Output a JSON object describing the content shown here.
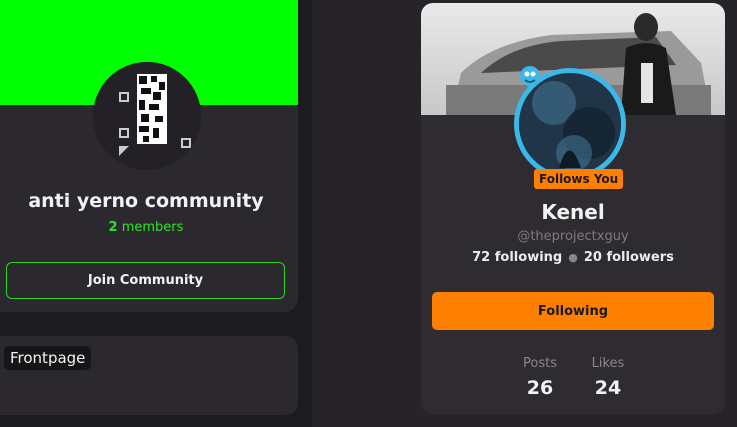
{
  "community": {
    "name": "anti yerno community",
    "member_count": "2",
    "member_label": "members",
    "join_label": "Join Community",
    "banner_color": "#00ff00"
  },
  "frontpage": {
    "label": "Frontpage"
  },
  "profile": {
    "follows_you_label": "Follows You",
    "name": "Kenel",
    "handle": "@theprojectxguy",
    "following_count": "72 following",
    "followers_count": "20 followers",
    "following_button_label": "Following",
    "stats": [
      {
        "label": "Posts",
        "value": "26"
      },
      {
        "label": "Likes",
        "value": "24"
      }
    ],
    "accent_color": "#ff7f00",
    "avatar_ring_color": "#3ab8e8"
  }
}
